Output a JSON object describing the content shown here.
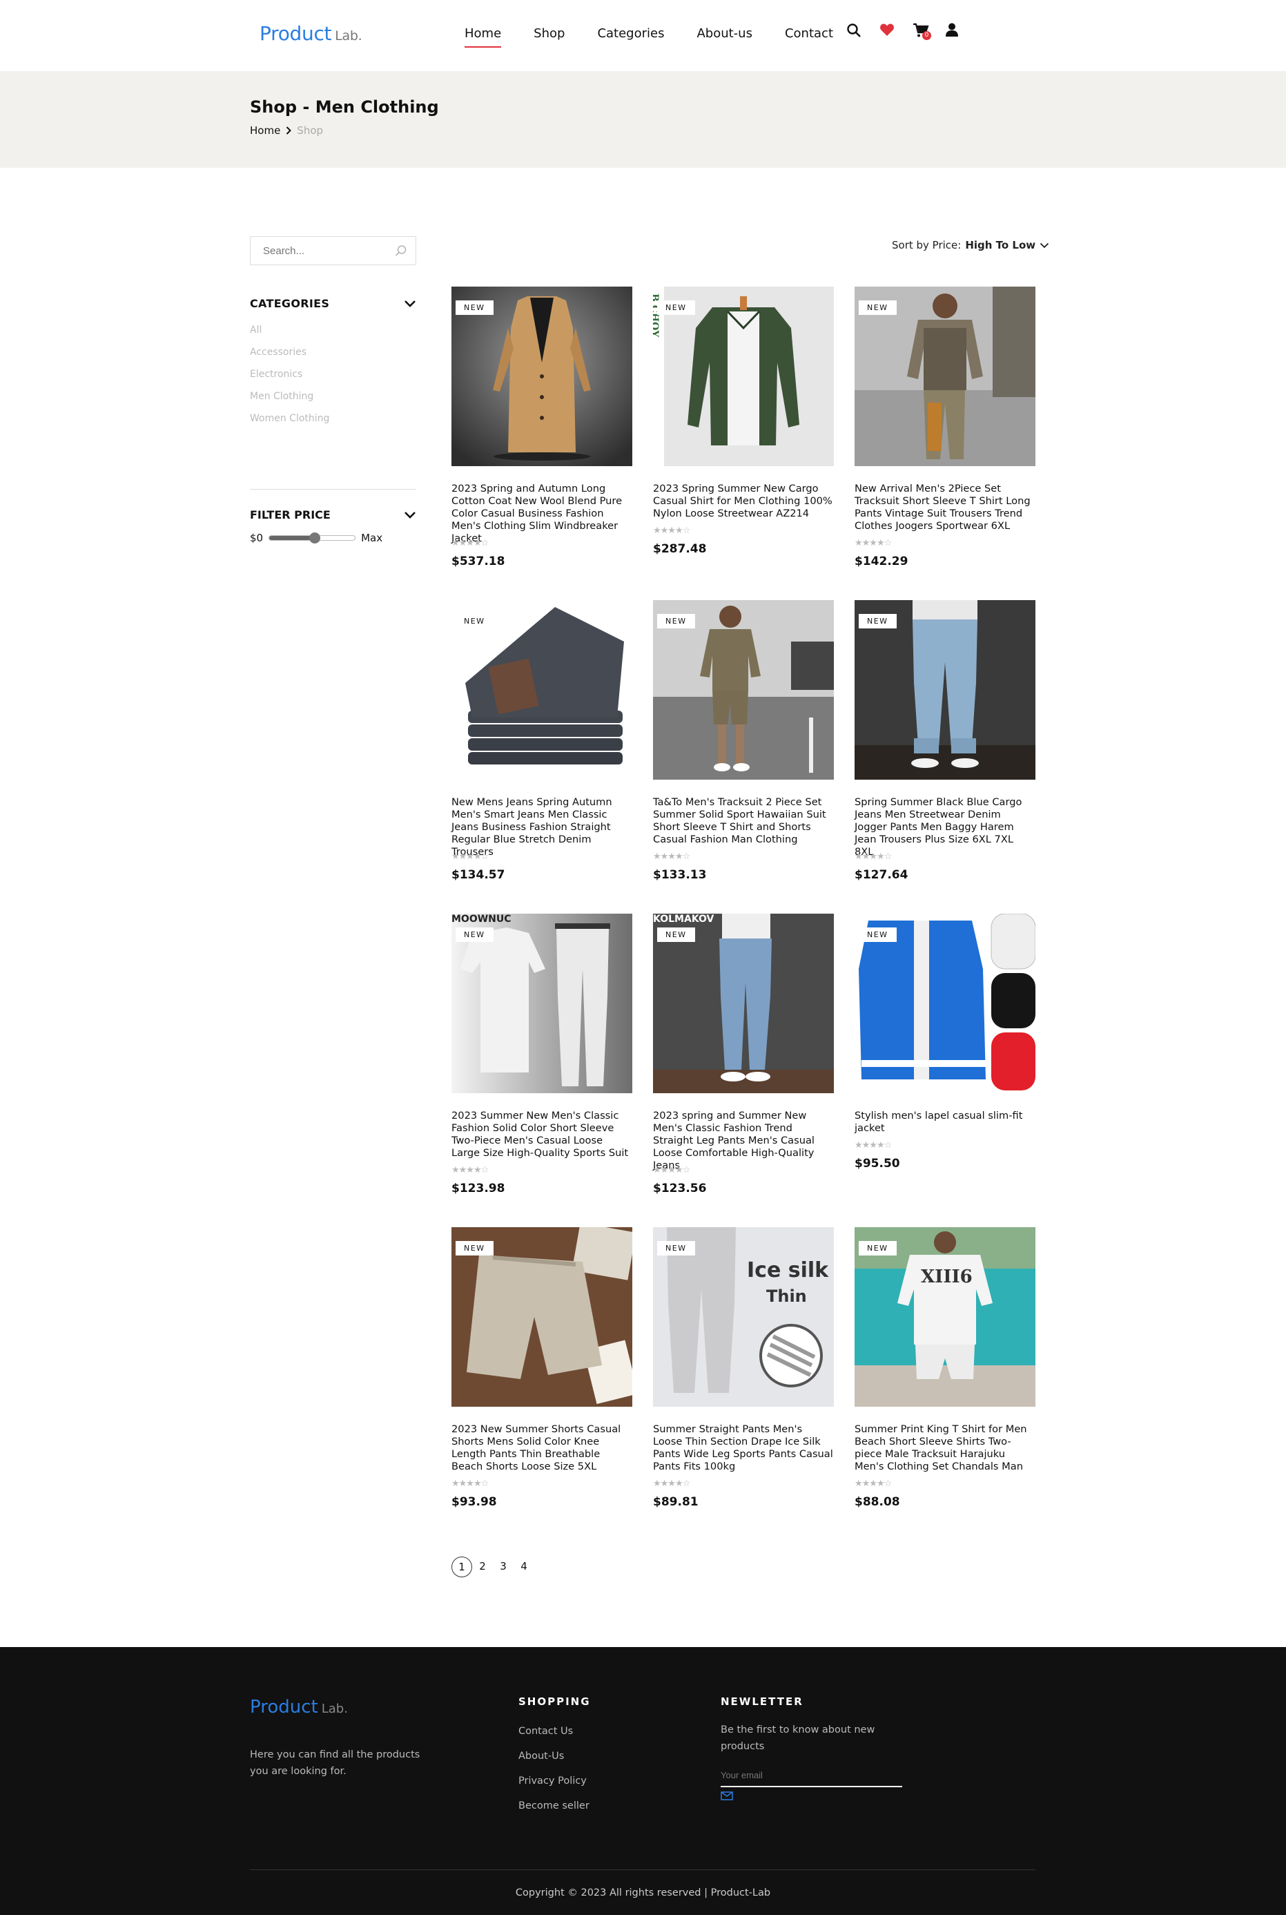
{
  "brand": {
    "name": "Product",
    "suffix": "Lab.",
    "color": "#2a7de1"
  },
  "nav": [
    {
      "label": "Home",
      "active": true
    },
    {
      "label": "Shop",
      "active": false
    },
    {
      "label": "Categories",
      "active": false
    },
    {
      "label": "About-us",
      "active": false
    },
    {
      "label": "Contact",
      "active": false
    }
  ],
  "header_icons": {
    "search": "search-icon",
    "wishlist": "heart-icon",
    "cart": "cart-icon",
    "cart_count": "0",
    "account": "user-icon"
  },
  "banner": {
    "title": "Shop - Men Clothing",
    "breadcrumb_home": "Home",
    "breadcrumb_current": "Shop"
  },
  "sidebar": {
    "search_placeholder": "Search...",
    "categories_title": "CATEGORIES",
    "categories": [
      "All",
      "Accessories",
      "Electronics",
      "Men Clothing",
      "Women Clothing"
    ],
    "filter_title": "FILTER PRICE",
    "min_label": "$0",
    "max_label": "Max",
    "slider_fraction": 0.5
  },
  "sort": {
    "label": "Sort by Price:",
    "value": "High To Low"
  },
  "new_label": "NEW",
  "stars": "★★★★☆",
  "products": [
    {
      "title": "2023 Spring and Autumn Long Cotton Coat New Wool Blend Pure Color Casual Business Fashion Men's Clothing Slim Windbreaker Jacket",
      "price": "$537.18",
      "rating": 4.5
    },
    {
      "title": "2023 Spring Summer New Cargo Casual Shirt for Men Clothing 100% Nylon Loose Streetwear AZ214",
      "price": "$287.48",
      "rating": 4.5
    },
    {
      "title": "New Arrival Men's 2Piece Set Tracksuit Short Sleeve T Shirt Long Pants Vintage Suit Trousers Trend Clothes Joogers Sportwear 6XL",
      "price": "$142.29",
      "rating": 4.5
    },
    {
      "title": "New Mens Jeans Spring Autumn Men's Smart Jeans Men Classic Jeans Business Fashion Straight Regular Blue Stretch Denim Trousers",
      "price": "$134.57",
      "rating": 4.5
    },
    {
      "title": "Ta&To Men's Tracksuit 2 Piece Set Summer Solid Sport Hawaiian Suit Short Sleeve T Shirt and Shorts Casual Fashion Man Clothing",
      "price": "$133.13",
      "rating": 4.5
    },
    {
      "title": "Spring Summer Black Blue Cargo Jeans Men Streetwear Denim Jogger Pants Men Baggy Harem Jean Trousers Plus Size 6XL 7XL 8XL",
      "price": "$127.64",
      "rating": 4.5
    },
    {
      "title": "2023 Summer New Men's Classic Fashion Solid Color Short Sleeve Two-Piece Men's Casual Loose Large Size High-Quality Sports Suit",
      "price": "$123.98",
      "rating": 4.5
    },
    {
      "title": "2023 spring and Summer New Men's Classic Fashion Trend Straight Leg Pants Men's Casual Loose Comfortable High-Quality Jeans",
      "price": "$123.56",
      "rating": 4.5
    },
    {
      "title": "Stylish men's lapel casual slim-fit jacket",
      "price": "$95.50",
      "rating": 4.5
    },
    {
      "title": "2023 New Summer Shorts Casual Shorts Mens Solid Color Knee Length Pants Thin Breathable Beach Shorts Loose Size 5XL",
      "price": "$93.98",
      "rating": 4.5
    },
    {
      "title": "Summer Straight Pants Men's Loose Thin Section Drape Ice Silk Pants Wide Leg Sports Pants Casual Pants Fits 100kg",
      "price": "$89.81",
      "rating": 4.5
    },
    {
      "title": "Summer Print King T Shirt for Men Beach Short Sleeve Shirts Two-piece Male Tracksuit Harajuku Men's Clothing Set Chandals Man",
      "price": "$88.08",
      "rating": 4.5
    }
  ],
  "image_text": {
    "p2": "B CHOY",
    "p7": "MOOWNUC",
    "p8": "KOLMAKOV",
    "p11a": "Ice silk",
    "p11b": "Thin",
    "p12": "XIII6"
  },
  "pagination": [
    "1",
    "2",
    "3",
    "4"
  ],
  "footer": {
    "desc": "Here you can find all the products you are looking for.",
    "shopping_title": "SHOPPING",
    "shopping_links": [
      "Contact Us",
      "About-Us",
      "Privacy Policy",
      "Become seller"
    ],
    "news_title": "NEWLETTER",
    "news_text": "Be the first to know about new products",
    "email_placeholder": "Your email",
    "copyright": "Copyright © 2023 All rights reserved | Product-Lab"
  }
}
